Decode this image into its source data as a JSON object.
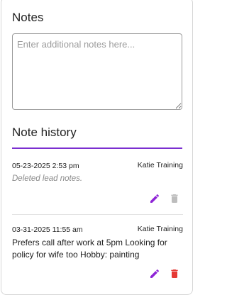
{
  "notes": {
    "label": "Notes",
    "placeholder": "Enter additional notes here...",
    "value": ""
  },
  "history": {
    "title": "Note history",
    "accent_color": "#7b2fd0",
    "entries": [
      {
        "date": "05-23-2025 2:53 pm",
        "author": "Katie Training",
        "text": "Deleted lead notes.",
        "deleted": true,
        "edit_icon": "pencil-icon",
        "delete_icon": "trash-icon",
        "edit_color": "#8e24d6",
        "delete_color": "#bdbdbd"
      },
      {
        "date": "03-31-2025 11:55 am",
        "author": "Katie Training",
        "text": "Prefers call after work at 5pm Looking for policy for wife too Hobby: painting",
        "deleted": false,
        "edit_icon": "pencil-icon",
        "delete_icon": "trash-icon",
        "edit_color": "#8e24d6",
        "delete_color": "#e53935"
      }
    ]
  }
}
